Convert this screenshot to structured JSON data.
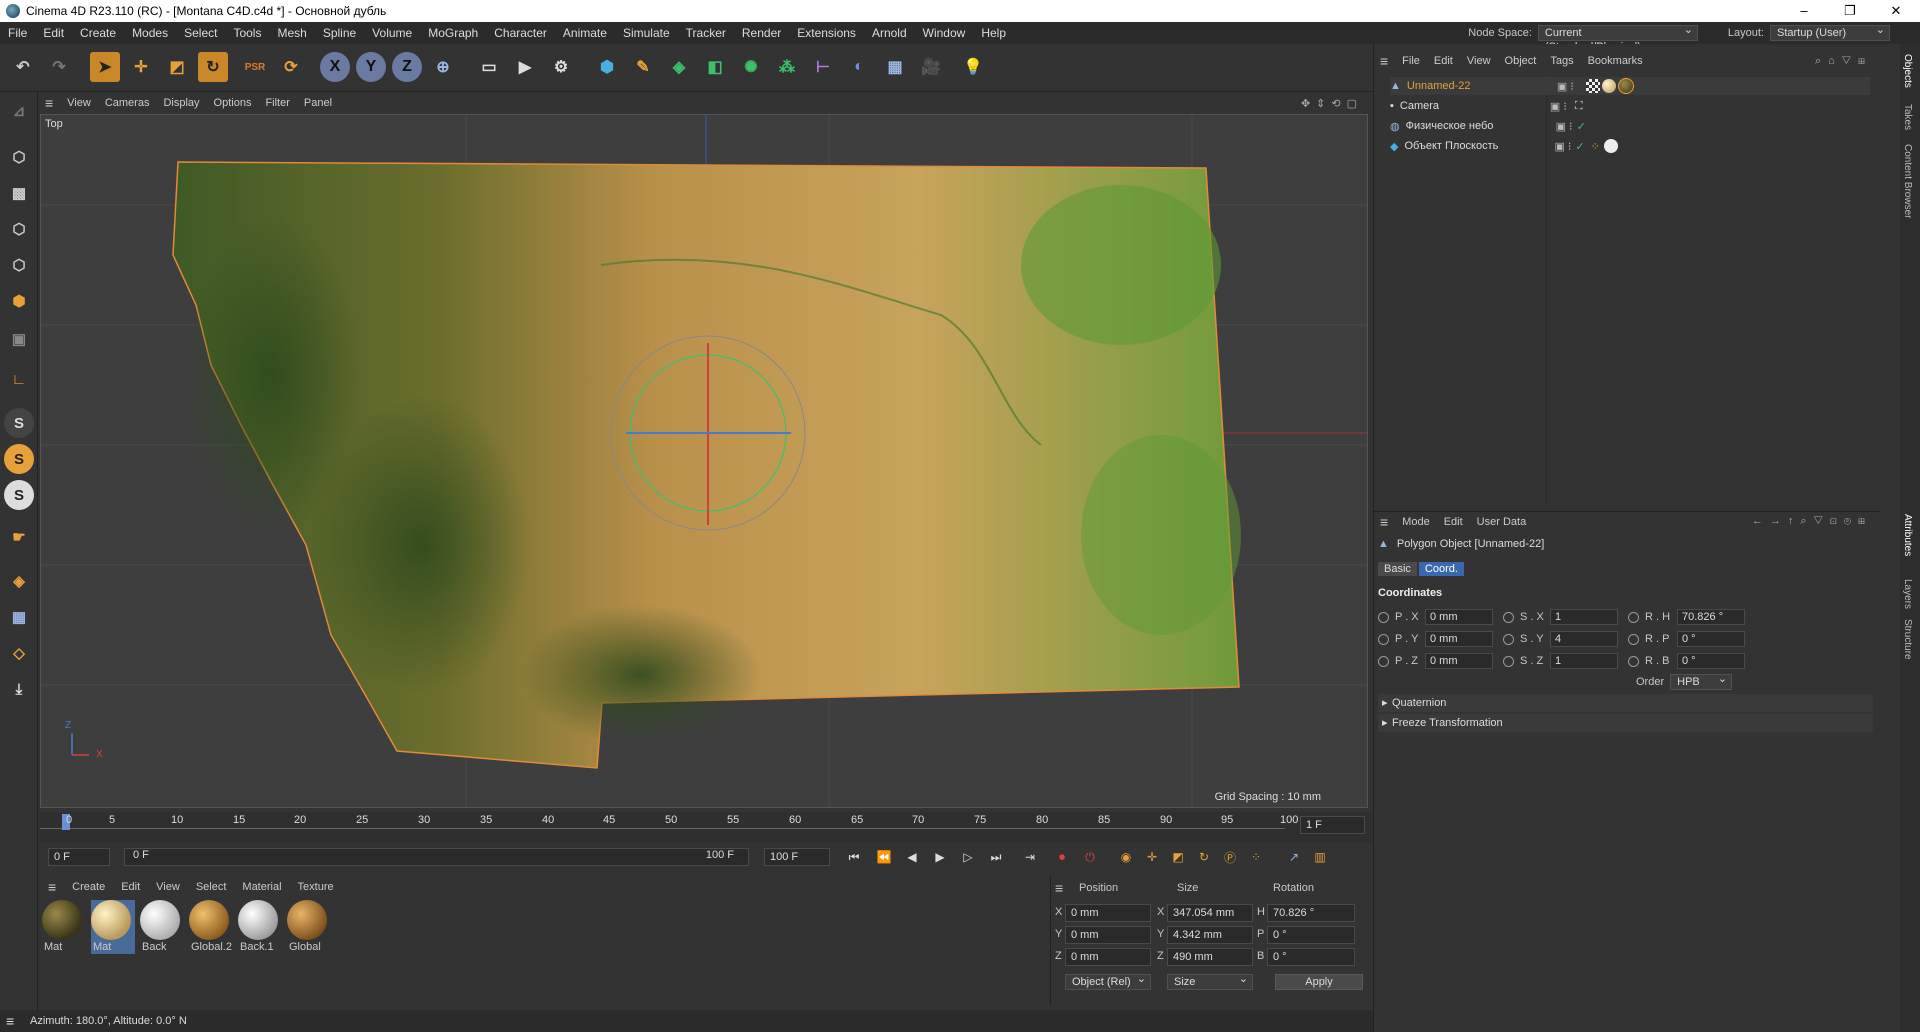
{
  "window": {
    "title": "Cinema 4D R23.110 (RC) - [Montana C4D.c4d *] - Основной дубль",
    "minimize": "–",
    "maximize": "❐",
    "close": "✕"
  },
  "menu": [
    "File",
    "Edit",
    "Create",
    "Modes",
    "Select",
    "Tools",
    "Mesh",
    "Spline",
    "Volume",
    "MoGraph",
    "Character",
    "Animate",
    "Simulate",
    "Tracker",
    "Render",
    "Extensions",
    "Arnold",
    "Window",
    "Help"
  ],
  "node_space": {
    "label": "Node Space:",
    "value": "Current (Standard/Physical)"
  },
  "layout": {
    "label": "Layout:",
    "value": "Startup (User)"
  },
  "viewport_menu": [
    "View",
    "Cameras",
    "Display",
    "Options",
    "Filter",
    "Panel"
  ],
  "viewport": {
    "name": "Top",
    "grid_spacing": "Grid Spacing : 10 mm",
    "axis_x": "X",
    "axis_z": "Z"
  },
  "timeline": {
    "ticks": [
      "0",
      "5",
      "10",
      "15",
      "20",
      "25",
      "30",
      "35",
      "40",
      "45",
      "50",
      "55",
      "60",
      "65",
      "70",
      "75",
      "80",
      "85",
      "90",
      "95",
      "100"
    ],
    "end_frame": "1 F"
  },
  "transport": {
    "start": "0 F",
    "range_start": "0 F",
    "range_end": "100 F",
    "end": "100 F"
  },
  "material_menu": [
    "Create",
    "Edit",
    "View",
    "Select",
    "Material",
    "Texture"
  ],
  "materials": [
    {
      "name": "Mat",
      "color": "#4a4420"
    },
    {
      "name": "Mat",
      "color": "#d9c38a"
    },
    {
      "name": "Back",
      "color": "#e8e8e8"
    },
    {
      "name": "Global.2",
      "color": "#c08a3a"
    },
    {
      "name": "Back.1",
      "color": "#dcdcdc"
    },
    {
      "name": "Global",
      "color": "#b8843f"
    }
  ],
  "coord_panel": {
    "headers": [
      "Position",
      "Size",
      "Rotation"
    ],
    "rows": [
      {
        "axis": "X",
        "pos": "0 mm",
        "size_axis": "X",
        "size": "347.054 mm",
        "rot_axis": "H",
        "rot": "70.826 °"
      },
      {
        "axis": "Y",
        "pos": "0 mm",
        "size_axis": "Y",
        "size": "4.342 mm",
        "rot_axis": "P",
        "rot": "0 °"
      },
      {
        "axis": "Z",
        "pos": "0 mm",
        "size_axis": "Z",
        "size": "490 mm",
        "rot_axis": "B",
        "rot": "0 °"
      }
    ],
    "mode": "Object (Rel)",
    "size_mode": "Size",
    "apply": "Apply"
  },
  "status": "Azimuth: 180.0°, Altitude: 0.0°  N",
  "object_menu": [
    "File",
    "Edit",
    "View",
    "Object",
    "Tags",
    "Bookmarks"
  ],
  "objects": [
    {
      "name": "Unnamed-22",
      "selected": true
    },
    {
      "name": "Camera",
      "selected": false
    },
    {
      "name": "Физическое небо",
      "selected": false
    },
    {
      "name": "Объект Плоскость",
      "selected": false
    }
  ],
  "attr_menu": [
    "Mode",
    "Edit",
    "User Data"
  ],
  "attributes": {
    "object_type": "Polygon Object [Unnamed-22]",
    "tabs": [
      "Basic",
      "Coord."
    ],
    "section": "Coordinates",
    "rows": [
      {
        "p": "P . X",
        "pv": "0 mm",
        "s": "S . X",
        "sv": "1",
        "r": "R . H",
        "rv": "70.826 °"
      },
      {
        "p": "P . Y",
        "pv": "0 mm",
        "s": "S . Y",
        "sv": "4",
        "r": "R . P",
        "rv": "0 °"
      },
      {
        "p": "P . Z",
        "pv": "0 mm",
        "s": "S . Z",
        "sv": "1",
        "r": "R . B",
        "rv": "0 °"
      }
    ],
    "order_label": "Order",
    "order": "HPB",
    "groups": [
      "Quaternion",
      "Freeze Transformation"
    ]
  },
  "side_tabs": [
    "Objects",
    "Takes",
    "Content Browser",
    "Attributes",
    "Layers",
    "Structure"
  ]
}
